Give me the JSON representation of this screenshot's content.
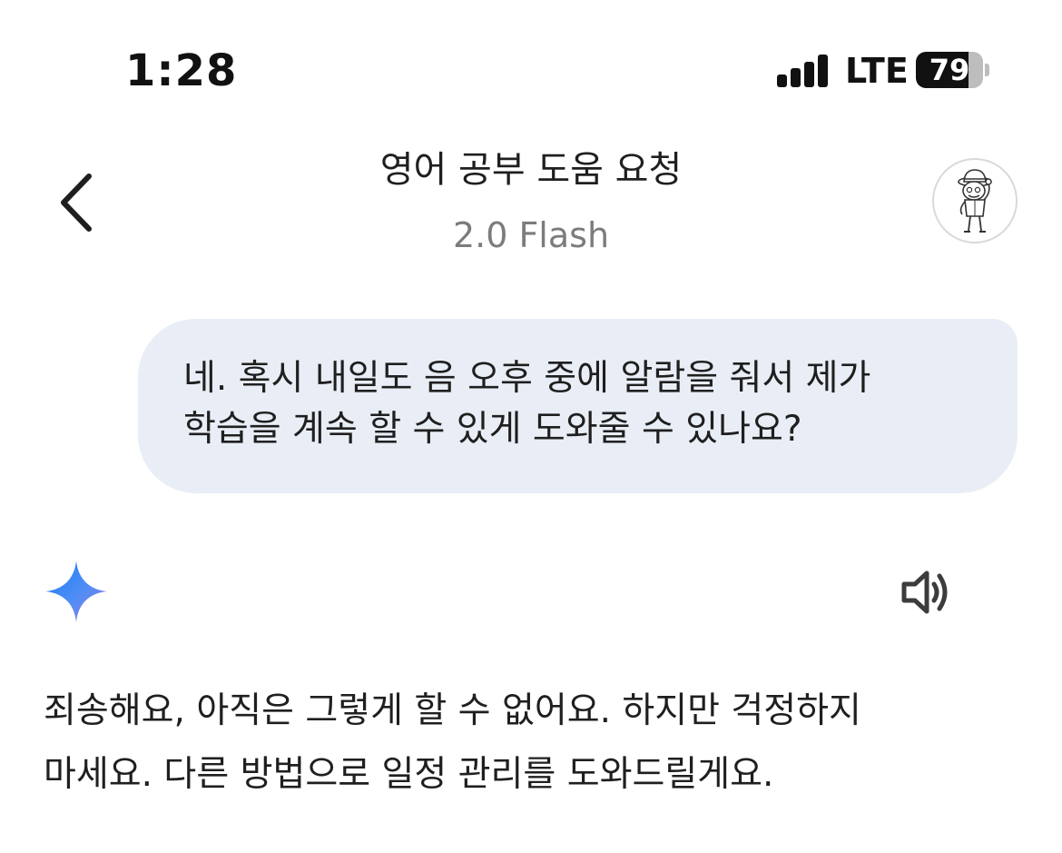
{
  "status_bar": {
    "time": "1:28",
    "network": "LTE",
    "battery_level": "79",
    "battery_fraction": 0.79,
    "signal_bars": 4,
    "signal_icon": "cellular-signal-icon",
    "battery_icon": "battery-icon"
  },
  "header": {
    "back_icon": "chevron-left-icon",
    "title": "영어 공부 도움 요청",
    "model": "2.0 Flash",
    "avatar_icon": "cartoon-avatar"
  },
  "conversation": {
    "user_message": "네. 혹시 내일도 음 오후 중에 알람을 줘서 제가\n학습을 계속 할 수 있게 도와줄 수 있나요?",
    "assistant_icon": "gemini-sparkle-icon",
    "speaker_icon": "speaker-icon",
    "assistant_message": "죄송해요, 아직은 그렇게 할 수 없어요. 하지만 걱정하지\n마세요. 다른 방법으로 일정 관리를 도와드릴게요."
  },
  "colors": {
    "user_bubble_bg": "#e9eef6",
    "text": "#1f1f1f",
    "subtitle": "#7c7c7c",
    "gemini_blue": "#4285f4",
    "gemini_purple": "#9b72cb"
  }
}
